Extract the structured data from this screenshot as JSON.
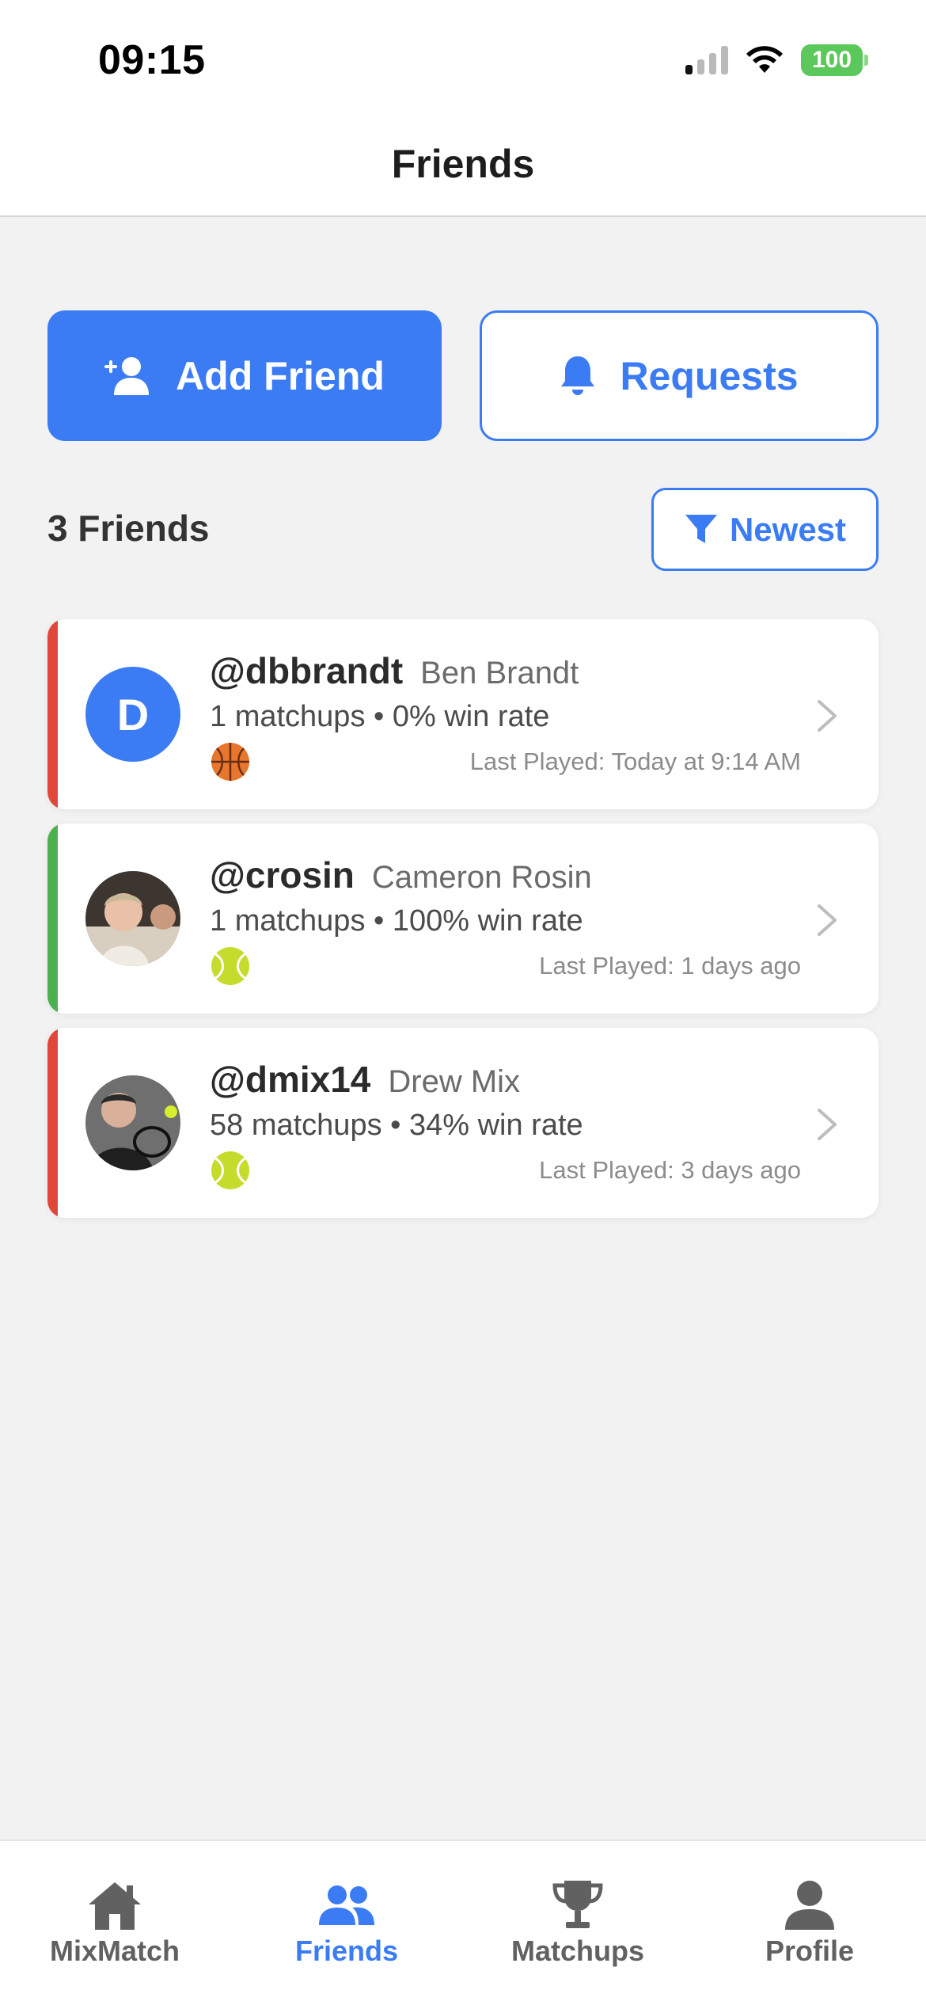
{
  "status_bar": {
    "time": "09:15",
    "battery": "100"
  },
  "header": {
    "title": "Friends"
  },
  "actions": {
    "add_friend": "Add Friend",
    "requests": "Requests"
  },
  "friends_count_label": "3 Friends",
  "filter": {
    "label": "Newest",
    "icon": "filter-icon"
  },
  "friends": [
    {
      "username": "@dbbrandt",
      "name": "Ben Brandt",
      "stats": "1 matchups • 0% win rate",
      "sport": "basketball",
      "last_played": "Last Played: Today at 9:14 AM",
      "avatar_letter": "D",
      "stripe": "#e0473a"
    },
    {
      "username": "@crosin",
      "name": "Cameron Rosin",
      "stats": "1 matchups • 100% win rate",
      "sport": "tennis",
      "last_played": "Last Played: 1 days ago",
      "avatar_letter": "",
      "stripe": "#4caf50"
    },
    {
      "username": "@dmix14",
      "name": "Drew Mix",
      "stats": "58 matchups • 34% win rate",
      "sport": "tennis",
      "last_played": "Last Played: 3 days ago",
      "avatar_letter": "",
      "stripe": "#e0473a"
    }
  ],
  "tabs": [
    {
      "label": "MixMatch",
      "icon": "home-icon"
    },
    {
      "label": "Friends",
      "icon": "friends-icon",
      "active": true
    },
    {
      "label": "Matchups",
      "icon": "trophy-icon"
    },
    {
      "label": "Profile",
      "icon": "profile-icon"
    }
  ],
  "colors": {
    "accent": "#3b7cf4",
    "loss": "#e0473a",
    "win": "#4caf50",
    "background": "#f2f2f3"
  }
}
